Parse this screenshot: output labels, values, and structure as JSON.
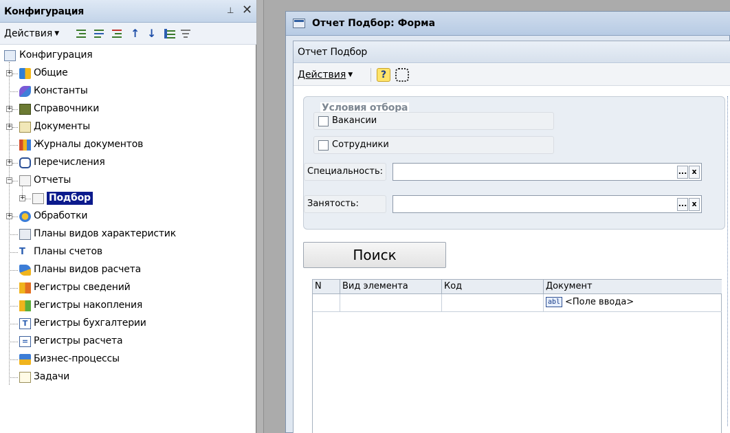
{
  "left_panel": {
    "title": "Конфигурация",
    "pin_icon": "⊥",
    "close_icon": "✕",
    "toolbar": {
      "actions_label": "Действия"
    },
    "tree": {
      "root": "Конфигурация",
      "items": [
        "Общие",
        "Константы",
        "Справочники",
        "Документы",
        "Журналы документов",
        "Перечисления",
        "Отчеты",
        "Подбор",
        "Обработки",
        "Планы видов характеристик",
        "Планы счетов",
        "Планы видов расчета",
        "Регистры сведений",
        "Регистры накопления",
        "Регистры бухгалтерии",
        "Регистры расчета",
        "Бизнес-процессы",
        "Задачи"
      ],
      "selected": "Подбор"
    }
  },
  "form": {
    "window_title": "Отчет Подбор: Форма",
    "header": "Отчет  Подбор",
    "toolbar": {
      "actions_label": "Действия",
      "help_label": "?"
    },
    "filter_group": {
      "legend": "Условия отбора",
      "checkboxes": [
        "Вакансии",
        "Сотрудники"
      ],
      "fields": [
        {
          "label": "Специальность:",
          "value": ""
        },
        {
          "label": "Занятость:",
          "value": ""
        }
      ],
      "select_button": "...",
      "clear_button": "x"
    },
    "search_button": "Поиск",
    "table": {
      "columns": [
        "N",
        "Вид элемента",
        "Код",
        "Документ"
      ],
      "rows": [
        [
          "",
          "",
          "",
          "<Поле ввода>"
        ]
      ],
      "field_icon_text": "abl"
    }
  }
}
